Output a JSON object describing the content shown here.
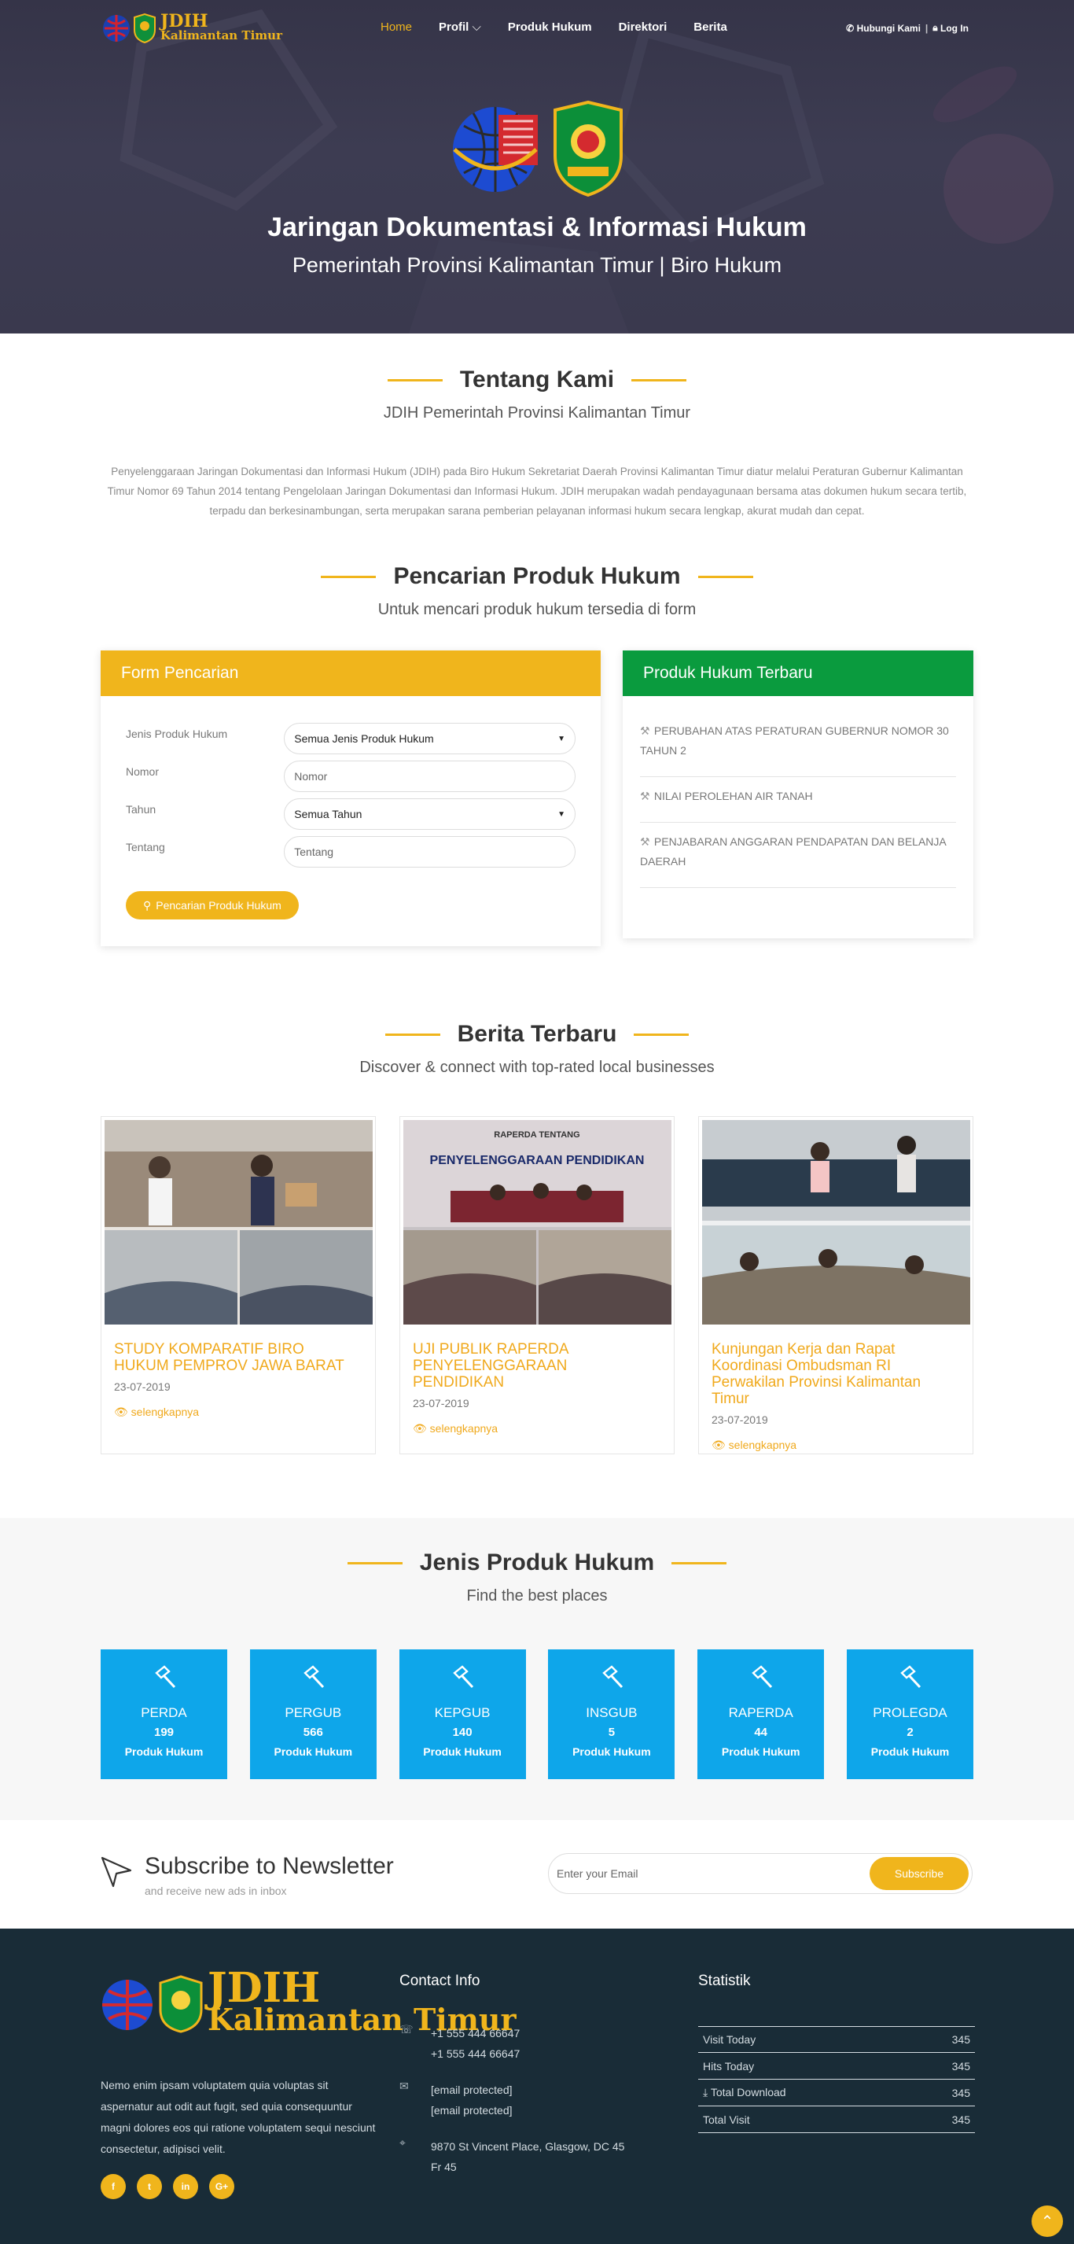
{
  "nav": {
    "logo_line1": "JDIH",
    "logo_line2": "Kalimantan Timur",
    "items": [
      {
        "label": "Home",
        "active": true
      },
      {
        "label": "Profil",
        "dropdown": true
      },
      {
        "label": "Produk Hukum"
      },
      {
        "label": "Direktori"
      },
      {
        "label": "Berita"
      }
    ],
    "contact_label": "Hubungi Kami",
    "login_label": "Log In"
  },
  "hero": {
    "title": "Jaringan Dokumentasi & Informasi Hukum",
    "subtitle": "Pemerintah Provinsi Kalimantan Timur | Biro Hukum"
  },
  "about": {
    "title": "Tentang Kami",
    "subtitle": "JDIH Pemerintah Provinsi Kalimantan Timur",
    "description": "Penyelenggaraan Jaringan Dokumentasi dan Informasi Hukum (JDIH) pada Biro Hukum Sekretariat Daerah Provinsi Kalimantan Timur diatur melalui Peraturan Gubernur Kalimantan Timur Nomor 69 Tahun 2014 tentang Pengelolaan Jaringan Dokumentasi dan Informasi Hukum. JDIH merupakan wadah pendayagunaan bersama atas dokumen hukum secara tertib, terpadu dan berkesinambungan, serta merupakan sarana pemberian pelayanan informasi hukum secara lengkap, akurat mudah dan cepat."
  },
  "search": {
    "title": "Pencarian Produk Hukum",
    "subtitle": "Untuk mencari produk hukum tersedia di form",
    "form_title": "Form Pencarian",
    "fields": {
      "jenis_label": "Jenis Produk Hukum",
      "jenis_value": "Semua Jenis Produk Hukum",
      "nomor_label": "Nomor",
      "nomor_placeholder": "Nomor",
      "tahun_label": "Tahun",
      "tahun_value": "Semua Tahun",
      "tentang_label": "Tentang",
      "tentang_placeholder": "Tentang"
    },
    "button_label": "Pencarian Produk Hukum",
    "latest_title": "Produk Hukum Terbaru",
    "latest_items": [
      "PERUBAHAN ATAS PERATURAN GUBERNUR NOMOR 30 TAHUN 2",
      "NILAI PEROLEHAN AIR TANAH",
      "PENJABARAN ANGGARAN PENDAPATAN DAN BELANJA DAERAH"
    ]
  },
  "news": {
    "title": "Berita Terbaru",
    "subtitle": "Discover & connect with top-rated local businesses",
    "items": [
      {
        "title": "STUDY KOMPARATIF BIRO HUKUM PEMPROV JAWA BARAT",
        "date": "23-07-2019",
        "more": "selengkapnya"
      },
      {
        "title": "UJI PUBLIK RAPERDA PENYELENGGARAAN PENDIDIKAN",
        "date": "23-07-2019",
        "more": "selengkapnya",
        "banner_line1": "RAPERDA TENTANG",
        "banner_line2": "PENYELENGGARAAN PENDIDIKAN"
      },
      {
        "title": "Kunjungan Kerja dan Rapat Koordinasi Ombudsman RI Perwakilan Provinsi Kalimantan Timur",
        "date": "23-07-2019",
        "more": "selengkapnya"
      }
    ]
  },
  "jenis": {
    "title": "Jenis Produk Hukum",
    "subtitle": "Find the best places",
    "items": [
      {
        "name": "PERDA",
        "count": "199",
        "label": "Produk Hukum"
      },
      {
        "name": "PERGUB",
        "count": "566",
        "label": "Produk Hukum"
      },
      {
        "name": "KEPGUB",
        "count": "140",
        "label": "Produk Hukum"
      },
      {
        "name": "INSGUB",
        "count": "5",
        "label": "Produk Hukum"
      },
      {
        "name": "RAPERDA",
        "count": "44",
        "label": "Produk Hukum"
      },
      {
        "name": "PROLEGDA",
        "count": "2",
        "label": "Produk Hukum"
      }
    ],
    "card_color": "#0ea6ea"
  },
  "newsletter": {
    "title": "Subscribe to Newsletter",
    "subtitle": "and receive new ads in inbox",
    "placeholder": "Enter your Email",
    "button": "Subscribe"
  },
  "footer": {
    "logo_line1": "JDIH",
    "logo_line2": "Kalimantan Timur",
    "description": "Nemo enim ipsam voluptatem quia voluptas sit aspernatur aut odit aut fugit, sed quia consequuntur magni dolores eos qui ratione voluptatem sequi nesciunt consectetur, adipisci velit.",
    "social": [
      {
        "icon": "facebook-icon",
        "glyph": "f"
      },
      {
        "icon": "twitter-icon",
        "glyph": "t"
      },
      {
        "icon": "linkedin-icon",
        "glyph": "in"
      },
      {
        "icon": "google-plus-icon",
        "glyph": "G+"
      }
    ],
    "contact_title": "Contact Info",
    "phone1": "+1 555 444 66647",
    "phone2": "+1 555 444 66647",
    "email1": "[email protected]",
    "email2": "[email protected]",
    "address_line1": "9870 St Vincent Place, Glasgow, DC 45",
    "address_line2": "Fr 45",
    "stats_title": "Statistik",
    "stats": [
      {
        "label": "Visit Today",
        "value": "345"
      },
      {
        "label": "Hits Today",
        "value": "345"
      },
      {
        "label": "Total Download",
        "value": "345"
      },
      {
        "label": "Total Visit",
        "value": "345"
      }
    ]
  },
  "colors": {
    "accent": "#f0b51c",
    "green": "#0a9b3e",
    "blue": "#0ea6ea",
    "footer_bg": "#192c37"
  }
}
